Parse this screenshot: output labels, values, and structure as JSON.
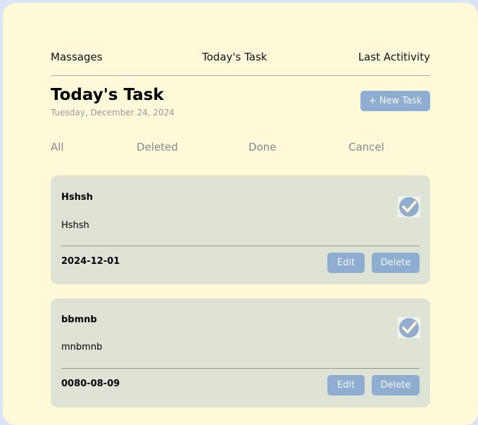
{
  "nav": {
    "messages": "Massages",
    "todays_task": "Today's Task",
    "last_activity": "Last Actitivity"
  },
  "header": {
    "title": "Today's Task",
    "date": "Tuesday, December 24, 2024",
    "new_task_label": "+ New Task"
  },
  "filters": {
    "all": "All",
    "deleted": "Deleted",
    "done": "Done",
    "cancel": "Cancel"
  },
  "tasks": [
    {
      "title": "Hshsh",
      "description": "Hshsh",
      "date": "2024-12-01",
      "done": true,
      "edit_label": "Edit",
      "delete_label": "Delete"
    },
    {
      "title": "bbmnb",
      "description": "mnbmnb",
      "date": "0080-08-09",
      "done": true,
      "edit_label": "Edit",
      "delete_label": "Delete"
    }
  ],
  "colors": {
    "page_bg": "#dbe4f7",
    "panel_bg": "#fef9d9",
    "card_bg": "#dee3d5",
    "button_bg": "#8fadd1",
    "check_circle": "#8fadd1"
  }
}
